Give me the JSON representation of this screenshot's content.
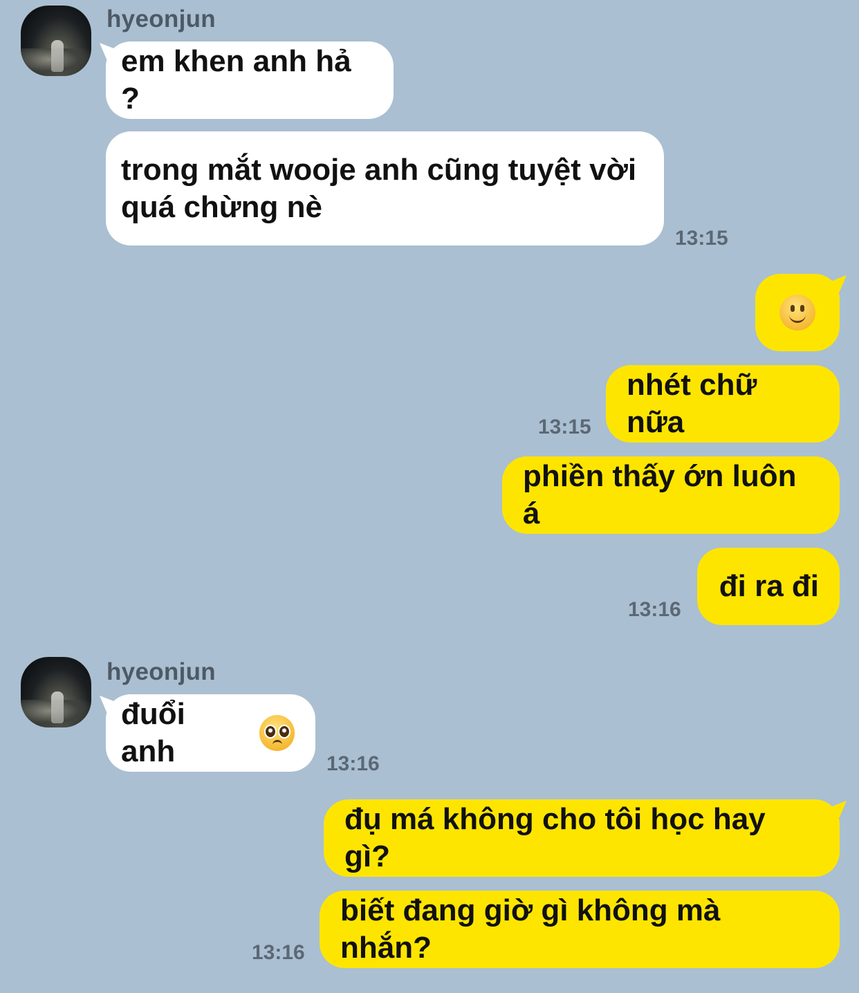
{
  "contact": {
    "name": "hyeonjun"
  },
  "groups": [
    {
      "sender": "hyeonjun",
      "messages": [
        {
          "text": "em khen anh hả ?"
        },
        {
          "text": "trong mắt wooje anh cũng tuyệt vời quá chừng nè",
          "time": "13:15"
        }
      ]
    },
    {
      "sender": "me",
      "messages": [
        {
          "emoji": "slightly-smiling-face"
        },
        {
          "text": "nhét chữ nữa",
          "time": "13:15"
        },
        {
          "text": "phiền thấy ớn luôn á"
        },
        {
          "text": "đi ra đi",
          "time": "13:16"
        }
      ]
    },
    {
      "sender": "hyeonjun",
      "messages": [
        {
          "text": "đuổi anh",
          "emoji": "pleading-face",
          "time": "13:16"
        }
      ]
    },
    {
      "sender": "me",
      "messages": [
        {
          "text": "đụ má không cho tôi học hay gì?"
        },
        {
          "text": "biết đang giờ gì không mà nhắn?",
          "time": "13:16"
        }
      ]
    }
  ],
  "colors": {
    "background": "#aabfd1",
    "incoming_bubble": "#ffffff",
    "outgoing_bubble": "#fee500",
    "timestamp": "#5b6875"
  }
}
